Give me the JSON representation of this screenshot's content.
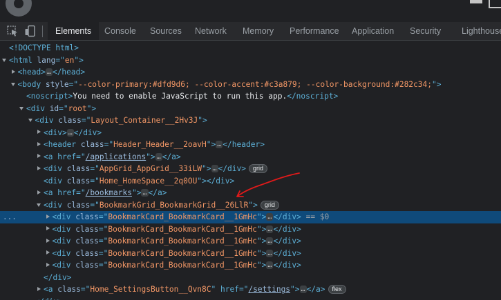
{
  "tabs": [
    "Elements",
    "Console",
    "Sources",
    "Network",
    "Memory",
    "Performance",
    "Application",
    "Security",
    "Lighthouse"
  ],
  "colors": {
    "panel_bg": "#202124",
    "selected_row": "#0f4a7a",
    "tag": "#5db0d7",
    "attr_name": "#9bbbdc",
    "attr_value": "#f29766",
    "annotation": "#e01a1a"
  },
  "icons": [
    "settings-gear-icon",
    "inspect-element-icon",
    "device-toolbar-icon"
  ],
  "dom": {
    "doctype": "<!DOCTYPE html>",
    "html_open": "<html lang=\"en\">",
    "head": {
      "open": "<head>",
      "close": "</head>"
    },
    "body_open": "<body style=\"--color-primary:#dfd9d6; --color-accent:#c3a879; --color-background:#282c34;\">",
    "noscript": {
      "open": "<noscript>",
      "text": "You need to enable JavaScript to run this app.",
      "close": "</noscript>"
    },
    "root_open": "<div id=\"root\">",
    "layout_open": "<div class=\"Layout_Container__2Hv3J\">",
    "div_collapsed": {
      "open": "<div>",
      "close": "</div>"
    },
    "header": {
      "open": "<header class=\"Header_Header__2oavH\">",
      "close": "</header>"
    },
    "applications_link": {
      "pre": "<a href=\"",
      "href": "/applications",
      "post": "\">",
      "close": "</a>"
    },
    "appgrid": {
      "open": "<div class=\"AppGrid_AppGrid__33iLW\">",
      "close": "</div>",
      "badge": "grid"
    },
    "homespace": {
      "open": "<div class=\"Home_HomeSpace__2q0OU\">",
      "close": "</div>"
    },
    "bookmarks_link": {
      "pre": "<a href=\"",
      "href": "/bookmarks",
      "post": "\">",
      "close": "</a>"
    },
    "bookmark_grid": {
      "open": "<div class=\"BookmarkGrid_BookmarkGrid__26LlR\">",
      "badge": "grid"
    },
    "bookmark_cards": [
      {
        "open": "<div class=\"BookmarkCard_BookmarkCard__1GmHc\">",
        "close": "</div>",
        "selected": true,
        "marker": "== $0"
      },
      {
        "open": "<div class=\"BookmarkCard_BookmarkCard__1GmHc\">",
        "close": "</div>"
      },
      {
        "open": "<div class=\"BookmarkCard_BookmarkCard__1GmHc\">",
        "close": "</div>"
      },
      {
        "open": "<div class=\"BookmarkCard_BookmarkCard__1GmHc\">",
        "close": "</div>"
      },
      {
        "open": "<div class=\"BookmarkCard_BookmarkCard__1GmHc\">",
        "close": "</div>"
      }
    ],
    "div_close": "</div>",
    "settings_link": {
      "pre": "<a class=\"Home_SettingsButton__Qvn8C\" href=\"",
      "href": "/settings",
      "post": "\">",
      "close": "</a>",
      "badge": "flex"
    },
    "trailing_close": "</div>"
  },
  "ellipsis": "…",
  "row_dots": "..."
}
